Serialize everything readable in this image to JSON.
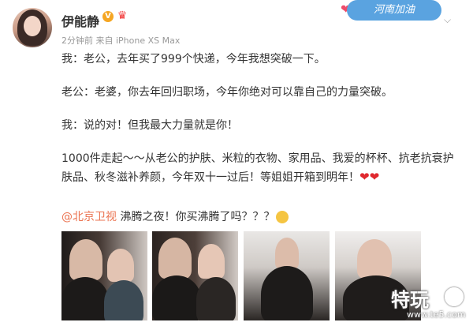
{
  "user": {
    "name": "伊能静",
    "meta": "2分钟前 来自 iPhone XS Max"
  },
  "banner": {
    "label": "河南加油"
  },
  "post": {
    "p1": "我：老公，去年买了999个快递，今年我想突破一下。",
    "p2": "老公：老婆，你去年回归职场，今年你绝对可以靠自己的力量突破。",
    "p3": "我：说的对！但我最大力量就是你！",
    "p4a": "1000件走起～～从老公的护肤、米粒的衣物、家用品、我爱的杯杯、抗老抗衰护",
    "p4b": "肤品、秋冬滋补养颜，今年双十一过后！等姐姐开箱到明年！",
    "hearts": "❤❤",
    "mention": "@北京卫视",
    "mention_text": " 沸腾之夜！你买沸腾了吗？？？"
  },
  "watermark": {
    "title": "特玩",
    "sub": "www.te5.com"
  },
  "icons": {
    "verified": "verified-icon",
    "crown": "crown-icon",
    "chevron": "chevron-down-icon",
    "emoji": "thinking-emoji-icon"
  },
  "colors": {
    "mention": "#eb7350",
    "verified": "#f5a623",
    "heart": "#e0282e"
  }
}
